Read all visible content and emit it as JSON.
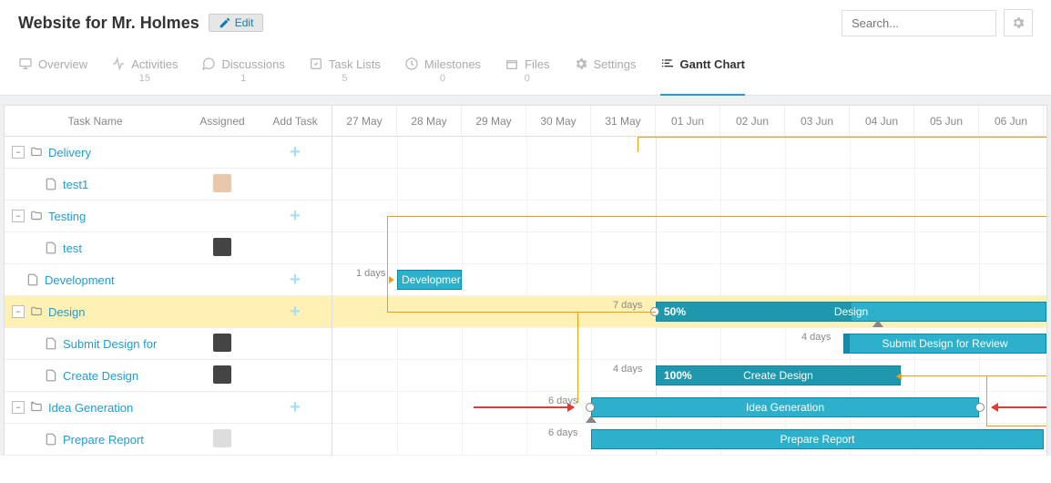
{
  "header": {
    "title": "Website for Mr. Holmes",
    "edit_label": "Edit",
    "search_placeholder": "Search..."
  },
  "tabs": {
    "overview": {
      "label": "Overview"
    },
    "activities": {
      "label": "Activities",
      "count": "15"
    },
    "discussions": {
      "label": "Discussions",
      "count": "1"
    },
    "tasklists": {
      "label": "Task Lists",
      "count": "5"
    },
    "milestones": {
      "label": "Milestones",
      "count": "0"
    },
    "files": {
      "label": "Files",
      "count": "0"
    },
    "settings": {
      "label": "Settings"
    },
    "gantt": {
      "label": "Gantt Chart"
    }
  },
  "columns": {
    "name": "Task Name",
    "assigned": "Assigned",
    "add": "Add Task"
  },
  "dates": [
    "27 May",
    "28 May",
    "29 May",
    "30 May",
    "31 May",
    "01 Jun",
    "02 Jun",
    "03 Jun",
    "04 Jun",
    "05 Jun",
    "06 Jun"
  ],
  "rows": {
    "delivery": "Delivery",
    "test1": "test1",
    "testing": "Testing",
    "test": "test",
    "development": "Development",
    "design": "Design",
    "submit": "Submit Design for",
    "create": "Create Design",
    "idea": "Idea Generation",
    "prepare": "Prepare Report"
  },
  "bars": {
    "development": {
      "label": "Developmen",
      "days": "1 days"
    },
    "design": {
      "label": "Design",
      "days": "7 days",
      "progress": "50%"
    },
    "submit": {
      "label": "Submit Design for Review",
      "days": "4 days"
    },
    "create": {
      "label": "Create Design",
      "days": "4 days",
      "progress": "100%"
    },
    "idea": {
      "label": "Idea Generation",
      "days": "6 days"
    },
    "prepare": {
      "label": "Prepare Report",
      "days": "6 days"
    }
  }
}
